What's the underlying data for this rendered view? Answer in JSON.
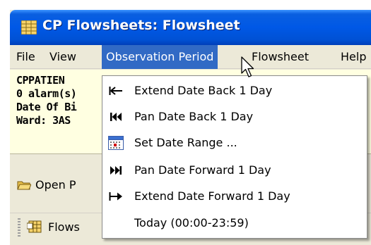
{
  "window": {
    "title": "CP Flowsheets: Flowsheet"
  },
  "menubar": {
    "items": [
      {
        "label": "File"
      },
      {
        "label": "View"
      },
      {
        "label": "Observation Period"
      },
      {
        "label": "Flowsheet"
      },
      {
        "label": "Help"
      }
    ]
  },
  "patient": {
    "name": "CPPATIEN",
    "alarms": "0 alarm(s)",
    "dob_label": "Date Of Bi",
    "ward": "Ward: 3AS"
  },
  "toolbar": {
    "open_label": "Open P",
    "flowsheets_label": "Flows"
  },
  "dropdown": {
    "items": [
      {
        "label": "Extend Date Back 1 Day",
        "icon": "extend-back-icon"
      },
      {
        "label": "Pan Date Back 1 Day",
        "icon": "pan-back-icon"
      },
      {
        "label": "Set Date Range ...",
        "icon": "calendar-icon"
      },
      {
        "label": "Pan Date Forward 1 Day",
        "icon": "pan-forward-icon"
      },
      {
        "label": "Extend Date Forward 1 Day",
        "icon": "extend-forward-icon"
      },
      {
        "label": "Today (00:00-23:59)",
        "icon": ""
      }
    ]
  },
  "colors": {
    "titlebar": "#0058e6",
    "menu_highlight": "#316ac5",
    "patient_panel": "#ffffe1",
    "window_bg": "#ece9d8"
  }
}
